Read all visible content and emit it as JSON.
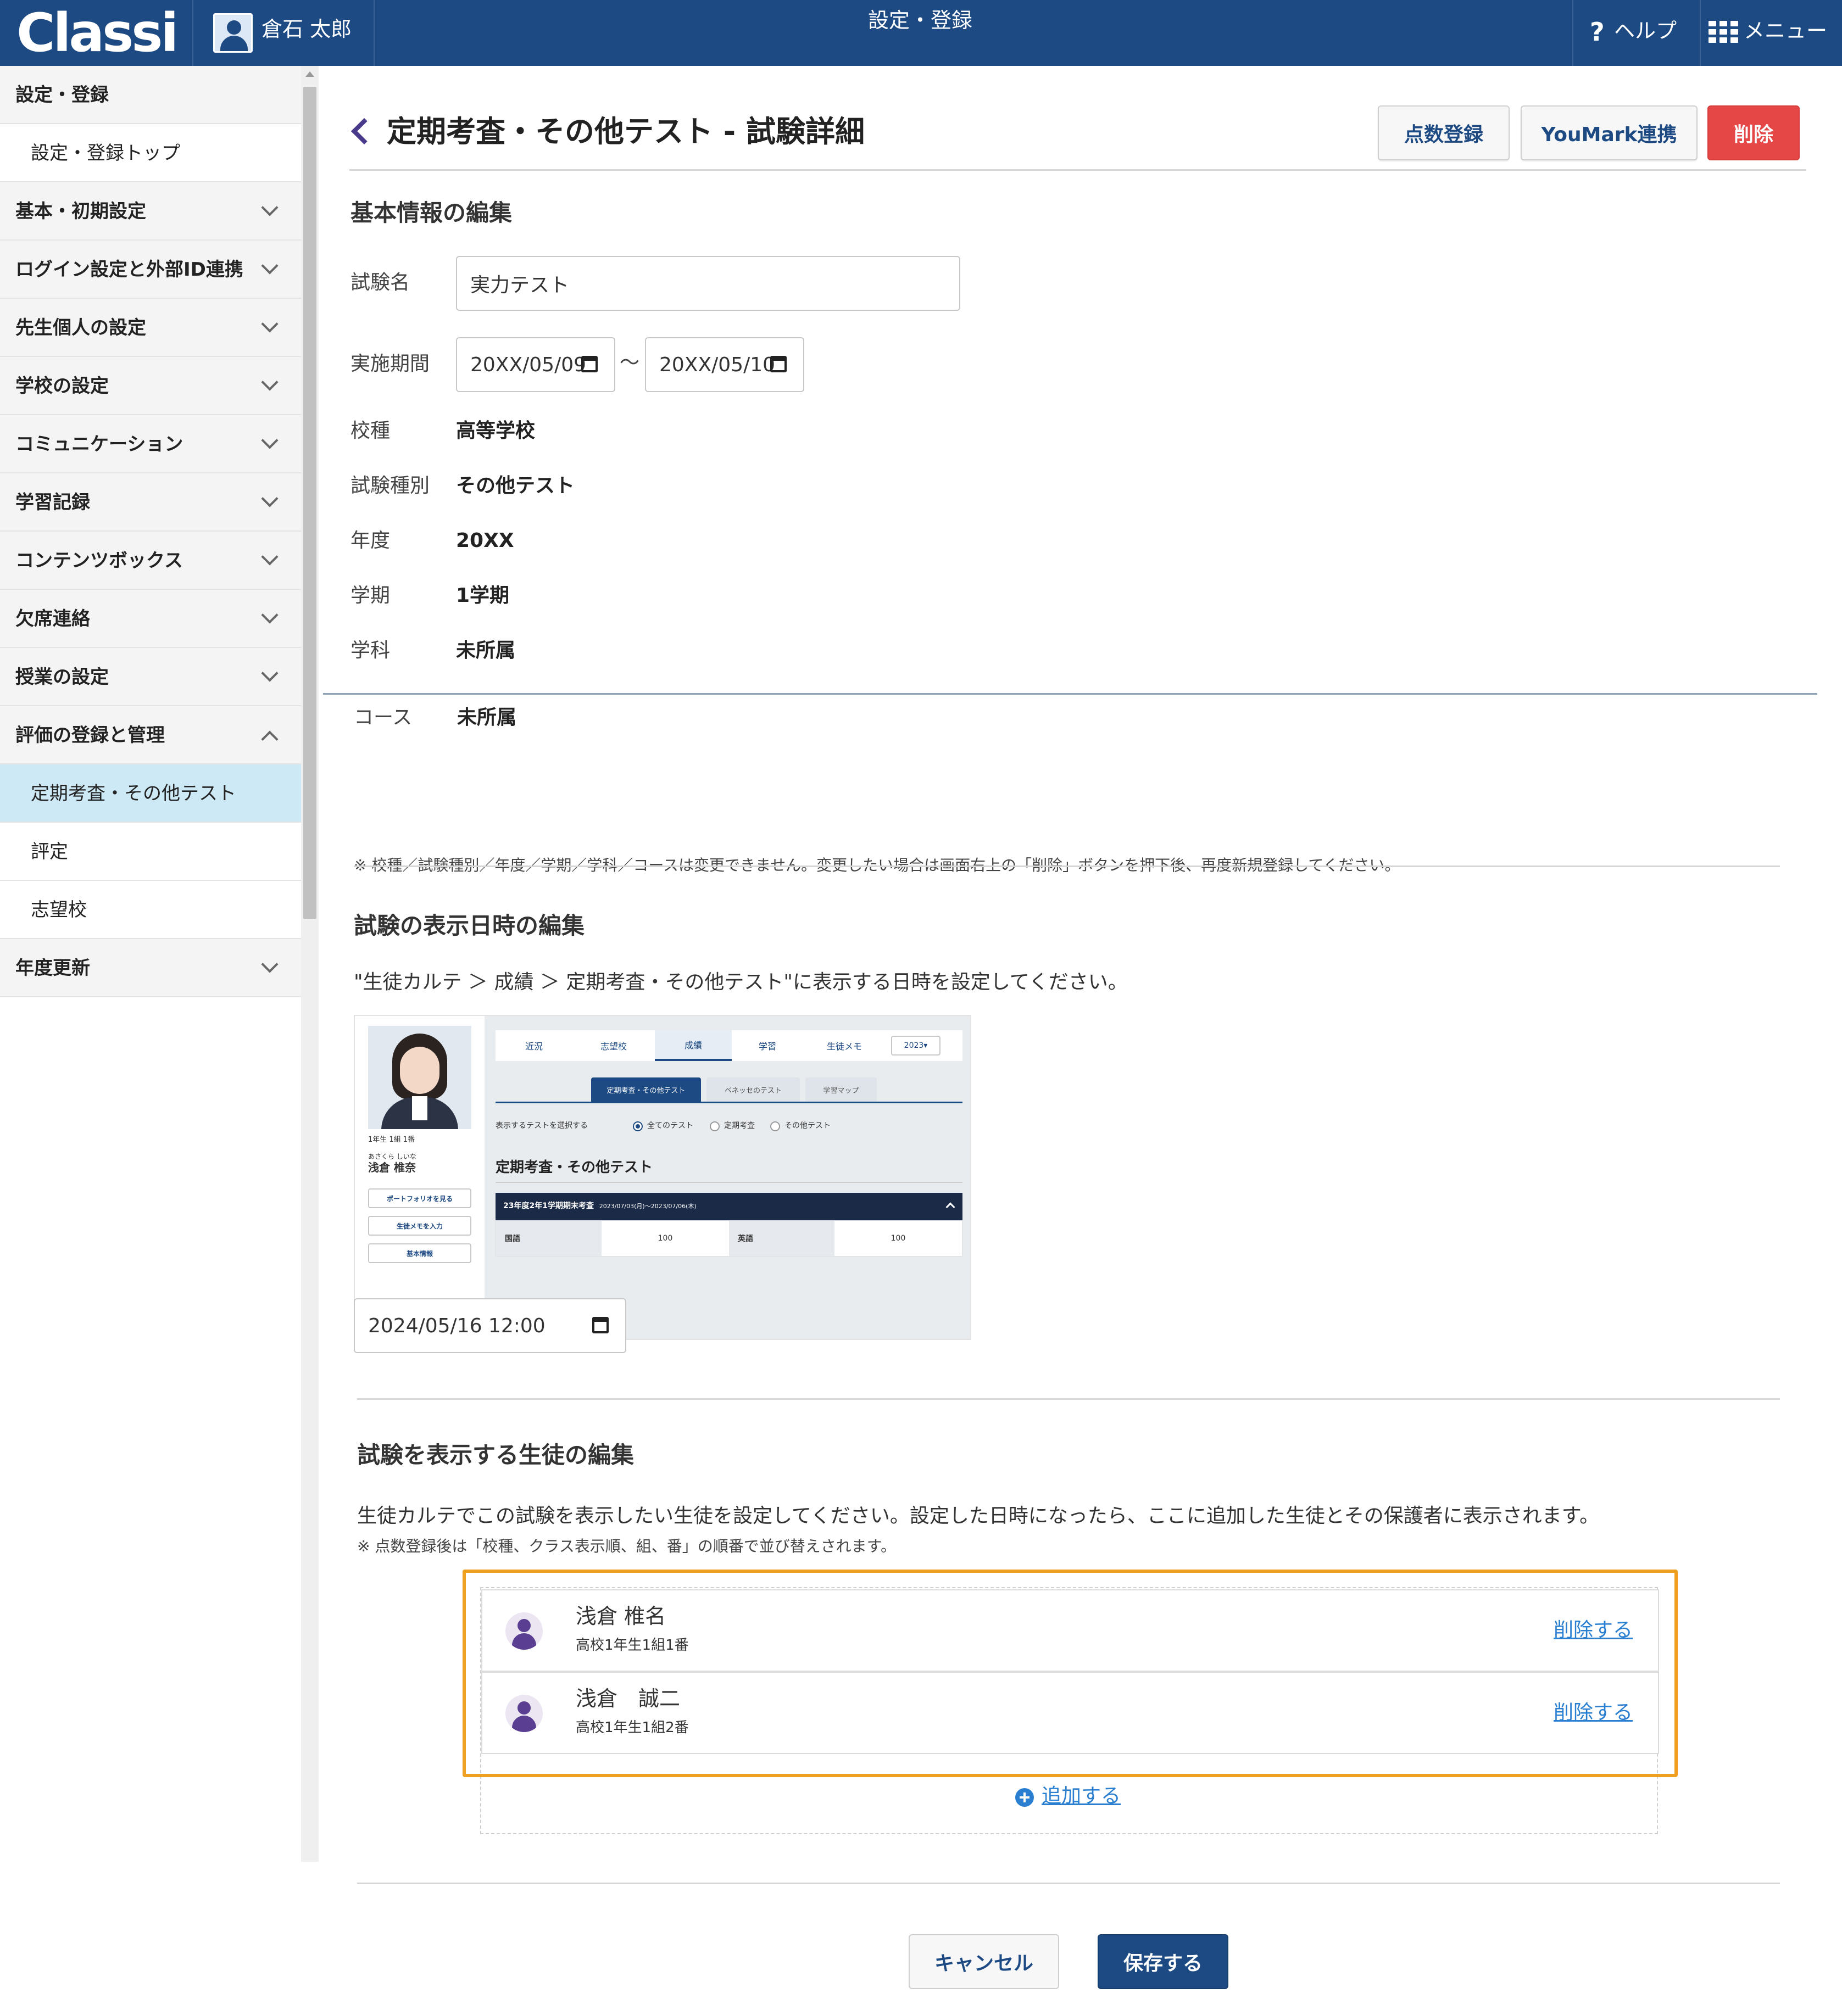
{
  "topbar": {
    "logo": "Classi",
    "user_name": "倉石 太郎",
    "title": "設定・登録",
    "help_label": "ヘルプ",
    "menu_label": "メニュー"
  },
  "sidebar": {
    "items": [
      {
        "label": "設定・登録",
        "type": "header"
      },
      {
        "label": "設定・登録トップ",
        "type": "child"
      },
      {
        "label": "基本・初期設定",
        "type": "group"
      },
      {
        "label": "ログイン設定と外部ID連携",
        "type": "group"
      },
      {
        "label": "先生個人の設定",
        "type": "group"
      },
      {
        "label": "学校の設定",
        "type": "group"
      },
      {
        "label": "コミュニケーション",
        "type": "group"
      },
      {
        "label": "学習記録",
        "type": "group"
      },
      {
        "label": "コンテンツボックス",
        "type": "group"
      },
      {
        "label": "欠席連絡",
        "type": "group"
      },
      {
        "label": "授業の設定",
        "type": "group"
      },
      {
        "label": "評価の登録と管理",
        "type": "group-open"
      },
      {
        "label": "定期考査・その他テスト",
        "type": "child-active"
      },
      {
        "label": "評定",
        "type": "child"
      },
      {
        "label": "志望校",
        "type": "child"
      },
      {
        "label": "年度更新",
        "type": "group"
      }
    ]
  },
  "header": {
    "title": "定期考査・その他テスト - 試験詳細",
    "buttons": {
      "score": "点数登録",
      "youmark": "YouMark連携",
      "delete": "削除"
    }
  },
  "basic": {
    "section_title": "基本情報の編集",
    "exam_name_label": "試験名",
    "exam_name_value": "実力テスト",
    "period_label": "実施期間",
    "period_start": "20XX/05/09",
    "period_sep": "〜",
    "period_end": "20XX/05/10",
    "rows": [
      {
        "label": "校種",
        "value": "高等学校"
      },
      {
        "label": "試験種別",
        "value": "その他テスト"
      },
      {
        "label": "年度",
        "value": "20XX"
      },
      {
        "label": "学期",
        "value": "1学期"
      },
      {
        "label": "学科",
        "value": "未所属"
      },
      {
        "label": "コース",
        "value": "未所属"
      }
    ],
    "note": "※ 校種／試験種別／年度／学期／学科／コースは変更できません。変更したい場合は画面右上の「削除」ボタンを押下後、再度新規登録してください。"
  },
  "display_date": {
    "section_title": "試験の表示日時の編集",
    "description": "\"生徒カルテ ＞ 成績 ＞ 定期考査・その他テスト\"に表示する日時を設定してください。",
    "datetime_value": "2024/05/16 12:00",
    "preview": {
      "grade_line": "1年生 1組 1番",
      "kana": "あさくら しいな",
      "student_name": "浅倉 椎奈",
      "buttons": [
        "ポートフォリオを見る",
        "生徒メモを入力",
        "基本情報"
      ],
      "tabs": [
        "近況",
        "志望校",
        "成績",
        "学習",
        "生徒メモ"
      ],
      "year": "2023▾",
      "subtabs": [
        "定期考査・その他テスト",
        "ベネッセのテスト",
        "学習マップ"
      ],
      "select_label": "表示するテストを選択する",
      "radios": [
        "全てのテスト",
        "定期考査",
        "その他テスト"
      ],
      "heading": "定期考査・その他テスト",
      "exam_title": "23年度2年1学期期末考査",
      "exam_dates": "2023/07/03(月)〜2023/07/06(木)",
      "scores": [
        {
          "subject": "国語",
          "score": "100"
        },
        {
          "subject": "英語",
          "score": "100"
        }
      ]
    }
  },
  "students": {
    "section_title": "試験を表示する生徒の編集",
    "description": "生徒カルテでこの試験を表示したい生徒を設定してください。設定した日時になったら、ここに追加した生徒とその保護者に表示されます。",
    "note": "※ 点数登録後は「校種、クラス表示順、組、番」の順番で並び替えされます。",
    "list": [
      {
        "name": "浅倉 椎名",
        "sub": "高校1年生1組1番",
        "delete": "削除する"
      },
      {
        "name": "浅倉　誠二",
        "sub": "高校1年生1組2番",
        "delete": "削除する"
      }
    ],
    "add_label": "追加する"
  },
  "footer": {
    "cancel": "キャンセル",
    "save": "保存する"
  },
  "colors": {
    "topbar": "#1d4a82",
    "danger": "#e54646",
    "link": "#2a7fd0",
    "highlight": "#f0a020",
    "sidebar_active": "#cde9f6"
  }
}
